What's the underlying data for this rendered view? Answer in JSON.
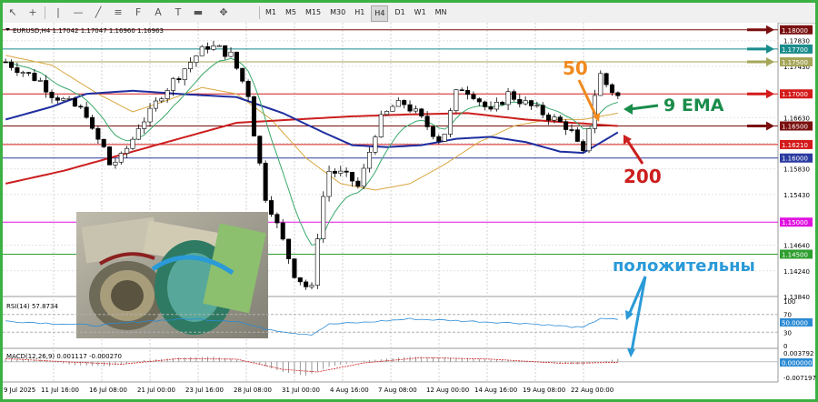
{
  "toolbar": {
    "icons": [
      {
        "name": "cursor-arrow-icon",
        "glyph": "↖"
      },
      {
        "name": "crosshair-icon",
        "glyph": "+"
      },
      {
        "name": "vertical-line-icon",
        "glyph": "|"
      },
      {
        "name": "horizontal-line-icon",
        "glyph": "—"
      },
      {
        "name": "trendline-icon",
        "glyph": "╱"
      },
      {
        "name": "channel-icon",
        "glyph": "≡"
      },
      {
        "name": "fibonacci-icon",
        "glyph": "F"
      },
      {
        "name": "text-icon",
        "glyph": "A"
      },
      {
        "name": "text-label-icon",
        "glyph": "T"
      },
      {
        "name": "rectangle-icon",
        "glyph": "▬"
      },
      {
        "name": "shapes-icon",
        "glyph": "✥"
      }
    ],
    "timeframes": [
      "M1",
      "M5",
      "M15",
      "M30",
      "H1",
      "H4",
      "D1",
      "W1",
      "MN"
    ],
    "active_timeframe": "H4"
  },
  "main": {
    "header": "EURUSD,H4  1.17042 1.17047 1.16960 1.16963",
    "price_ticks": [
      "1.17830",
      "1.17430",
      "1.16630",
      "1.16230",
      "1.15830",
      "1.15430",
      "1.14640",
      "1.14240",
      "1.13840"
    ],
    "level_labels": [
      {
        "text": "1.18000",
        "bg": "#7a0f0f",
        "arrow": "#7a0f0f",
        "price": 1.18
      },
      {
        "text": "1.17700",
        "bg": "#1a8c8c",
        "arrow": "#1a8c8c",
        "price": 1.177
      },
      {
        "text": "1.17500",
        "bg": "#a6a65a",
        "arrow": "#a6a65a",
        "price": 1.175
      },
      {
        "text": "1.17000",
        "bg": "#d41a1a",
        "arrow": "#d41a1a",
        "price": 1.17
      },
      {
        "text": "1.16500",
        "bg": "#7a0f0f",
        "arrow": "#7a0f0f",
        "price": 1.165
      },
      {
        "text": "1.16210",
        "bg": "#d41a1a",
        "arrow": "",
        "price": 1.1621
      },
      {
        "text": "1.16000",
        "bg": "#2a3aa0",
        "arrow": "",
        "price": 1.16
      },
      {
        "text": "1.15000",
        "bg": "#e012e0",
        "arrow": "",
        "price": 1.15
      },
      {
        "text": "1.14500",
        "bg": "#2e9e2e",
        "arrow": "",
        "price": 1.145
      }
    ],
    "annotations": {
      "ema50": "50",
      "ema9": "9 EMA",
      "ema200": "200",
      "positive": "положительны"
    }
  },
  "rsi": {
    "label": "RSI(14) 57.8734",
    "ticks": [
      "100",
      "70",
      "30",
      "0"
    ],
    "value_badge": "50.0000"
  },
  "macd": {
    "label": "MACD(12,26,9) 0.001117 -0.000270",
    "ticks": [
      "0.003792",
      "-0.007197"
    ],
    "value_badge": "0.000000"
  },
  "dates": [
    "9 Jul 2025",
    "11 Jul 16:00",
    "16 Jul 08:00",
    "21 Jul 00:00",
    "23 Jul 16:00",
    "28 Jul 08:00",
    "31 Jul 00:00",
    "4 Aug 16:00",
    "7 Aug 08:00",
    "12 Aug 00:00",
    "14 Aug 16:00",
    "19 Aug 08:00",
    "22 Aug 00:00"
  ],
  "colors": {
    "sma200": "#cc1f1f",
    "ema100": "#1e2ea0",
    "sma50": "#d9a741",
    "ema9": "#3aa86a",
    "candle": "#000000",
    "rsi": "#2a8ad4",
    "macd_hist": "#707070",
    "macd_signal": "#d02020"
  },
  "chart_data": {
    "type": "candlestick",
    "symbol": "EURUSD",
    "timeframe": "H4",
    "ylim": [
      1.1384,
      1.1811
    ],
    "close_path": [
      [
        0,
        1.175
      ],
      [
        3,
        1.1735
      ],
      [
        6,
        1.172
      ],
      [
        8,
        1.17
      ],
      [
        10,
        1.169
      ],
      [
        12,
        1.168
      ],
      [
        14,
        1.167
      ],
      [
        15,
        1.164
      ],
      [
        17,
        1.1615
      ],
      [
        18,
        1.159
      ],
      [
        20,
        1.16
      ],
      [
        22,
        1.163
      ],
      [
        23,
        1.165
      ],
      [
        25,
        1.167
      ],
      [
        27,
        1.17
      ],
      [
        29,
        1.172
      ],
      [
        31,
        1.174
      ],
      [
        33,
        1.176
      ],
      [
        35,
        1.1775
      ],
      [
        37,
        1.177
      ],
      [
        39,
        1.176
      ],
      [
        40,
        1.174
      ],
      [
        42,
        1.17
      ],
      [
        43,
        1.164
      ],
      [
        44,
        1.159
      ],
      [
        45,
        1.154
      ],
      [
        46,
        1.152
      ],
      [
        48,
        1.147
      ],
      [
        50,
        1.142
      ],
      [
        51,
        1.141
      ],
      [
        52,
        1.14
      ],
      [
        53,
        1.1395
      ],
      [
        54,
        1.148
      ],
      [
        55,
        1.154
      ],
      [
        56,
        1.158
      ],
      [
        58,
        1.1575
      ],
      [
        60,
        1.1565
      ],
      [
        61,
        1.1555
      ],
      [
        62,
        1.158
      ],
      [
        63,
        1.161
      ],
      [
        64,
        1.164
      ],
      [
        65,
        1.166
      ],
      [
        67,
        1.168
      ],
      [
        69,
        1.1685
      ],
      [
        71,
        1.167
      ],
      [
        73,
        1.165
      ],
      [
        75,
        1.163
      ],
      [
        76,
        1.164
      ],
      [
        77,
        1.167
      ],
      [
        78,
        1.17
      ],
      [
        79,
        1.171
      ],
      [
        81,
        1.17
      ],
      [
        83,
        1.168
      ],
      [
        84,
        1.167
      ],
      [
        86,
        1.169
      ],
      [
        87,
        1.17
      ],
      [
        89,
        1.169
      ],
      [
        91,
        1.168
      ],
      [
        93,
        1.167
      ],
      [
        95,
        1.166
      ],
      [
        97,
        1.165
      ],
      [
        98,
        1.164
      ],
      [
        99,
        1.162
      ],
      [
        100,
        1.1605
      ],
      [
        101,
        1.165
      ],
      [
        102,
        1.17
      ],
      [
        103,
        1.173
      ],
      [
        104,
        1.1715
      ],
      [
        105,
        1.1705
      ],
      [
        106,
        1.1696
      ]
    ],
    "n_bars": 107,
    "sma200": [
      [
        0,
        1.156
      ],
      [
        10,
        1.158
      ],
      [
        20,
        1.1605
      ],
      [
        30,
        1.163
      ],
      [
        40,
        1.1655
      ],
      [
        50,
        1.166
      ],
      [
        60,
        1.1665
      ],
      [
        70,
        1.1668
      ],
      [
        80,
        1.167
      ],
      [
        90,
        1.166
      ],
      [
        106,
        1.165
      ]
    ],
    "ema100": [
      [
        0,
        1.166
      ],
      [
        8,
        1.168
      ],
      [
        14,
        1.17
      ],
      [
        22,
        1.1705
      ],
      [
        30,
        1.17
      ],
      [
        40,
        1.1695
      ],
      [
        48,
        1.167
      ],
      [
        55,
        1.164
      ],
      [
        60,
        1.162
      ],
      [
        66,
        1.1617
      ],
      [
        72,
        1.162
      ],
      [
        78,
        1.163
      ],
      [
        84,
        1.1633
      ],
      [
        90,
        1.1625
      ],
      [
        96,
        1.161
      ],
      [
        100,
        1.1608
      ],
      [
        106,
        1.164
      ]
    ],
    "sma50": [
      [
        0,
        1.176
      ],
      [
        8,
        1.1745
      ],
      [
        16,
        1.17
      ],
      [
        22,
        1.1672
      ],
      [
        28,
        1.169
      ],
      [
        34,
        1.171
      ],
      [
        40,
        1.17
      ],
      [
        46,
        1.166
      ],
      [
        52,
        1.16
      ],
      [
        58,
        1.156
      ],
      [
        64,
        1.155
      ],
      [
        70,
        1.156
      ],
      [
        76,
        1.159
      ],
      [
        82,
        1.1625
      ],
      [
        88,
        1.165
      ],
      [
        94,
        1.166
      ],
      [
        100,
        1.166
      ],
      [
        106,
        1.167
      ]
    ],
    "ema9_offset_bars": 2,
    "rsi_range": [
      0,
      100
    ],
    "rsi_path": [
      [
        0,
        55
      ],
      [
        8,
        50
      ],
      [
        16,
        45
      ],
      [
        24,
        55
      ],
      [
        32,
        60
      ],
      [
        40,
        55
      ],
      [
        44,
        40
      ],
      [
        50,
        28
      ],
      [
        53,
        25
      ],
      [
        56,
        48
      ],
      [
        62,
        52
      ],
      [
        70,
        60
      ],
      [
        80,
        55
      ],
      [
        90,
        50
      ],
      [
        100,
        40
      ],
      [
        103,
        62
      ],
      [
        106,
        57.9
      ]
    ],
    "macd_range": [
      -0.007197,
      0.003792
    ],
    "macd_hist": [
      [
        0,
        0.001
      ],
      [
        6,
        0.0008
      ],
      [
        12,
        -0.0014
      ],
      [
        18,
        -0.0018
      ],
      [
        24,
        0.0006
      ],
      [
        30,
        0.0016
      ],
      [
        36,
        0.002
      ],
      [
        42,
        0.0002
      ],
      [
        48,
        -0.004
      ],
      [
        52,
        -0.0055
      ],
      [
        56,
        -0.002
      ],
      [
        62,
        0.0004
      ],
      [
        70,
        0.002
      ],
      [
        80,
        0.0014
      ],
      [
        90,
        0.0002
      ],
      [
        100,
        -0.0012
      ],
      [
        106,
        0.0011
      ]
    ],
    "macd_signal": [
      [
        0,
        0.0012
      ],
      [
        10,
        0.0
      ],
      [
        20,
        -0.001
      ],
      [
        30,
        0.0012
      ],
      [
        40,
        0.001
      ],
      [
        48,
        -0.003
      ],
      [
        54,
        -0.004
      ],
      [
        62,
        -0.0005
      ],
      [
        72,
        0.0016
      ],
      [
        84,
        0.001
      ],
      [
        96,
        -0.0006
      ],
      [
        106,
        -0.0003
      ]
    ]
  }
}
